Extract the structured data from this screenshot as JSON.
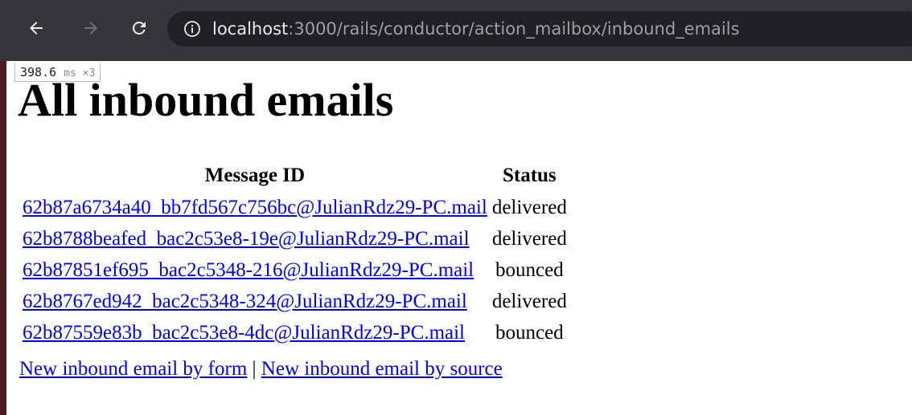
{
  "browser": {
    "url_host": "localhost",
    "url_rest": ":3000/rails/conductor/action_mailbox/inbound_emails"
  },
  "perf_badge": {
    "value": "398.6",
    "unit": "ms ×3"
  },
  "page": {
    "title": "All inbound emails",
    "table": {
      "headers": [
        "Message ID",
        "Status"
      ],
      "rows": [
        {
          "message_id": "62b87a6734a40_bb7fd567c756bc@JulianRdz29-PC.mail",
          "status": "delivered"
        },
        {
          "message_id": "62b8788beafed_bac2c53e8-19e@JulianRdz29-PC.mail",
          "status": "delivered"
        },
        {
          "message_id": "62b87851ef695_bac2c5348-216@JulianRdz29-PC.mail",
          "status": "bounced"
        },
        {
          "message_id": "62b8767ed942_bac2c5348-324@JulianRdz29-PC.mail",
          "status": "delivered"
        },
        {
          "message_id": "62b87559e83b_bac2c53e8-4dc@JulianRdz29-PC.mail",
          "status": "bounced"
        }
      ]
    },
    "footer": {
      "link_form": "New inbound email by form",
      "separator": "|",
      "link_source": "New inbound email by source"
    }
  },
  "colors": {
    "toolbar": "#35363a",
    "omnibox": "#202124",
    "link": "#0000ee",
    "sidebar": "#4a1b20"
  },
  "icons": [
    "back-arrow-icon",
    "forward-arrow-icon",
    "reload-icon",
    "info-icon"
  ]
}
